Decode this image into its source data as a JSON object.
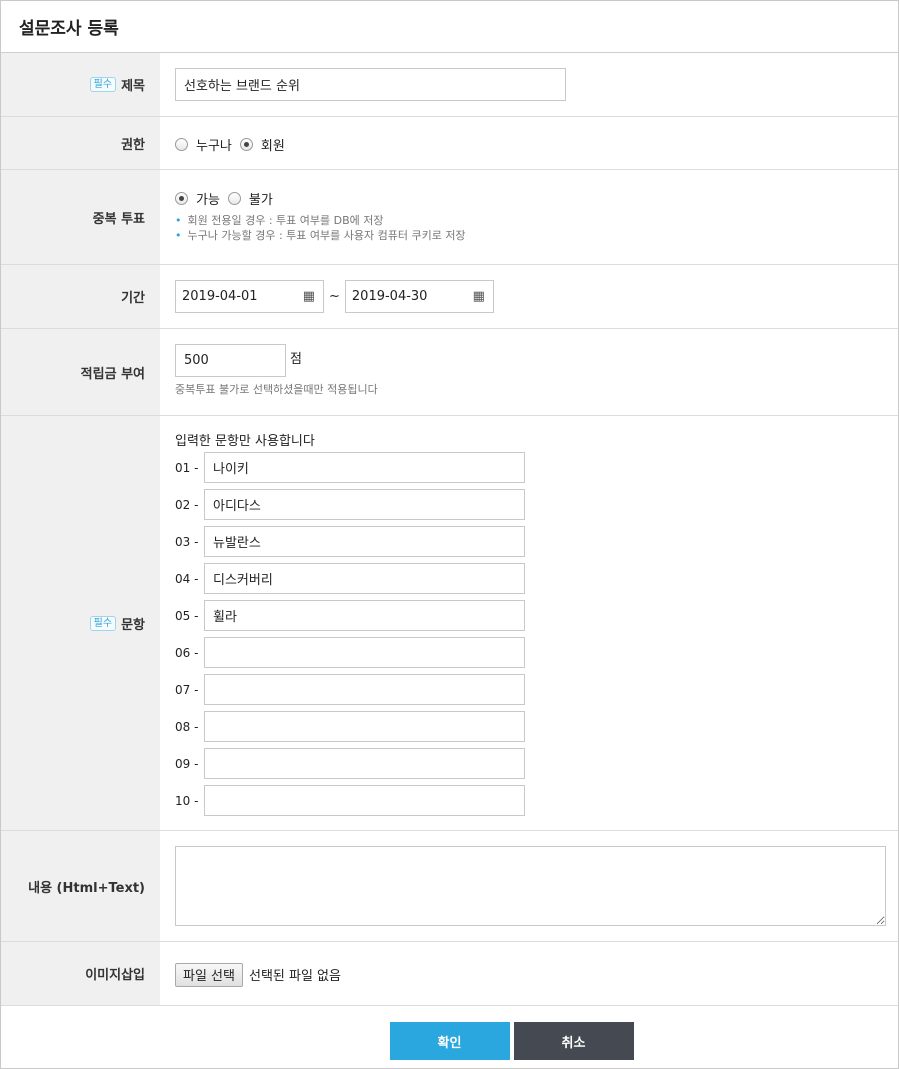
{
  "page_title": "설문조사 등록",
  "required_badge": "필수",
  "title_field": {
    "label": "제목",
    "value": "선호하는 브랜드 순위"
  },
  "permission": {
    "label": "권한",
    "options": [
      "누구나",
      "회원"
    ],
    "selected": "회원"
  },
  "duplicate_vote": {
    "label": "중복 투표",
    "options": [
      "가능",
      "불가"
    ],
    "selected": "가능",
    "notes": [
      "회원 전용일 경우 : 투표 여부를 DB에 저장",
      "누구나 가능할 경우 : 투표 여부를 사용자 컴퓨터 쿠키로 저장"
    ]
  },
  "period": {
    "label": "기간",
    "start": "2019-04-01",
    "separator": "~",
    "end": "2019-04-30",
    "calendar_icon": "calendar-icon"
  },
  "points": {
    "label": "적립금 부여",
    "value": "500",
    "unit": "점",
    "note": "중복투표 불가로 선택하셨을때만 적용됩니다"
  },
  "questions": {
    "label": "문항",
    "hint": "입력한 문항만 사용합니다",
    "items": [
      {
        "num": "01 -",
        "value": "나이키"
      },
      {
        "num": "02 -",
        "value": "아디다스"
      },
      {
        "num": "03 -",
        "value": "뉴발란스"
      },
      {
        "num": "04 -",
        "value": "디스커버리"
      },
      {
        "num": "05 -",
        "value": "휠라"
      },
      {
        "num": "06 -",
        "value": ""
      },
      {
        "num": "07 -",
        "value": ""
      },
      {
        "num": "08 -",
        "value": ""
      },
      {
        "num": "09 -",
        "value": ""
      },
      {
        "num": "10 -",
        "value": ""
      }
    ]
  },
  "content": {
    "label": "내용 (Html+Text)",
    "value": ""
  },
  "image": {
    "label": "이미지삽입",
    "button": "파일 선택",
    "status": "선택된 파일 없음"
  },
  "actions": {
    "confirm": "확인",
    "cancel": "취소"
  },
  "colors": {
    "confirm": "#2aa7df",
    "cancel": "#454a52",
    "accent": "#2fa1d8"
  }
}
